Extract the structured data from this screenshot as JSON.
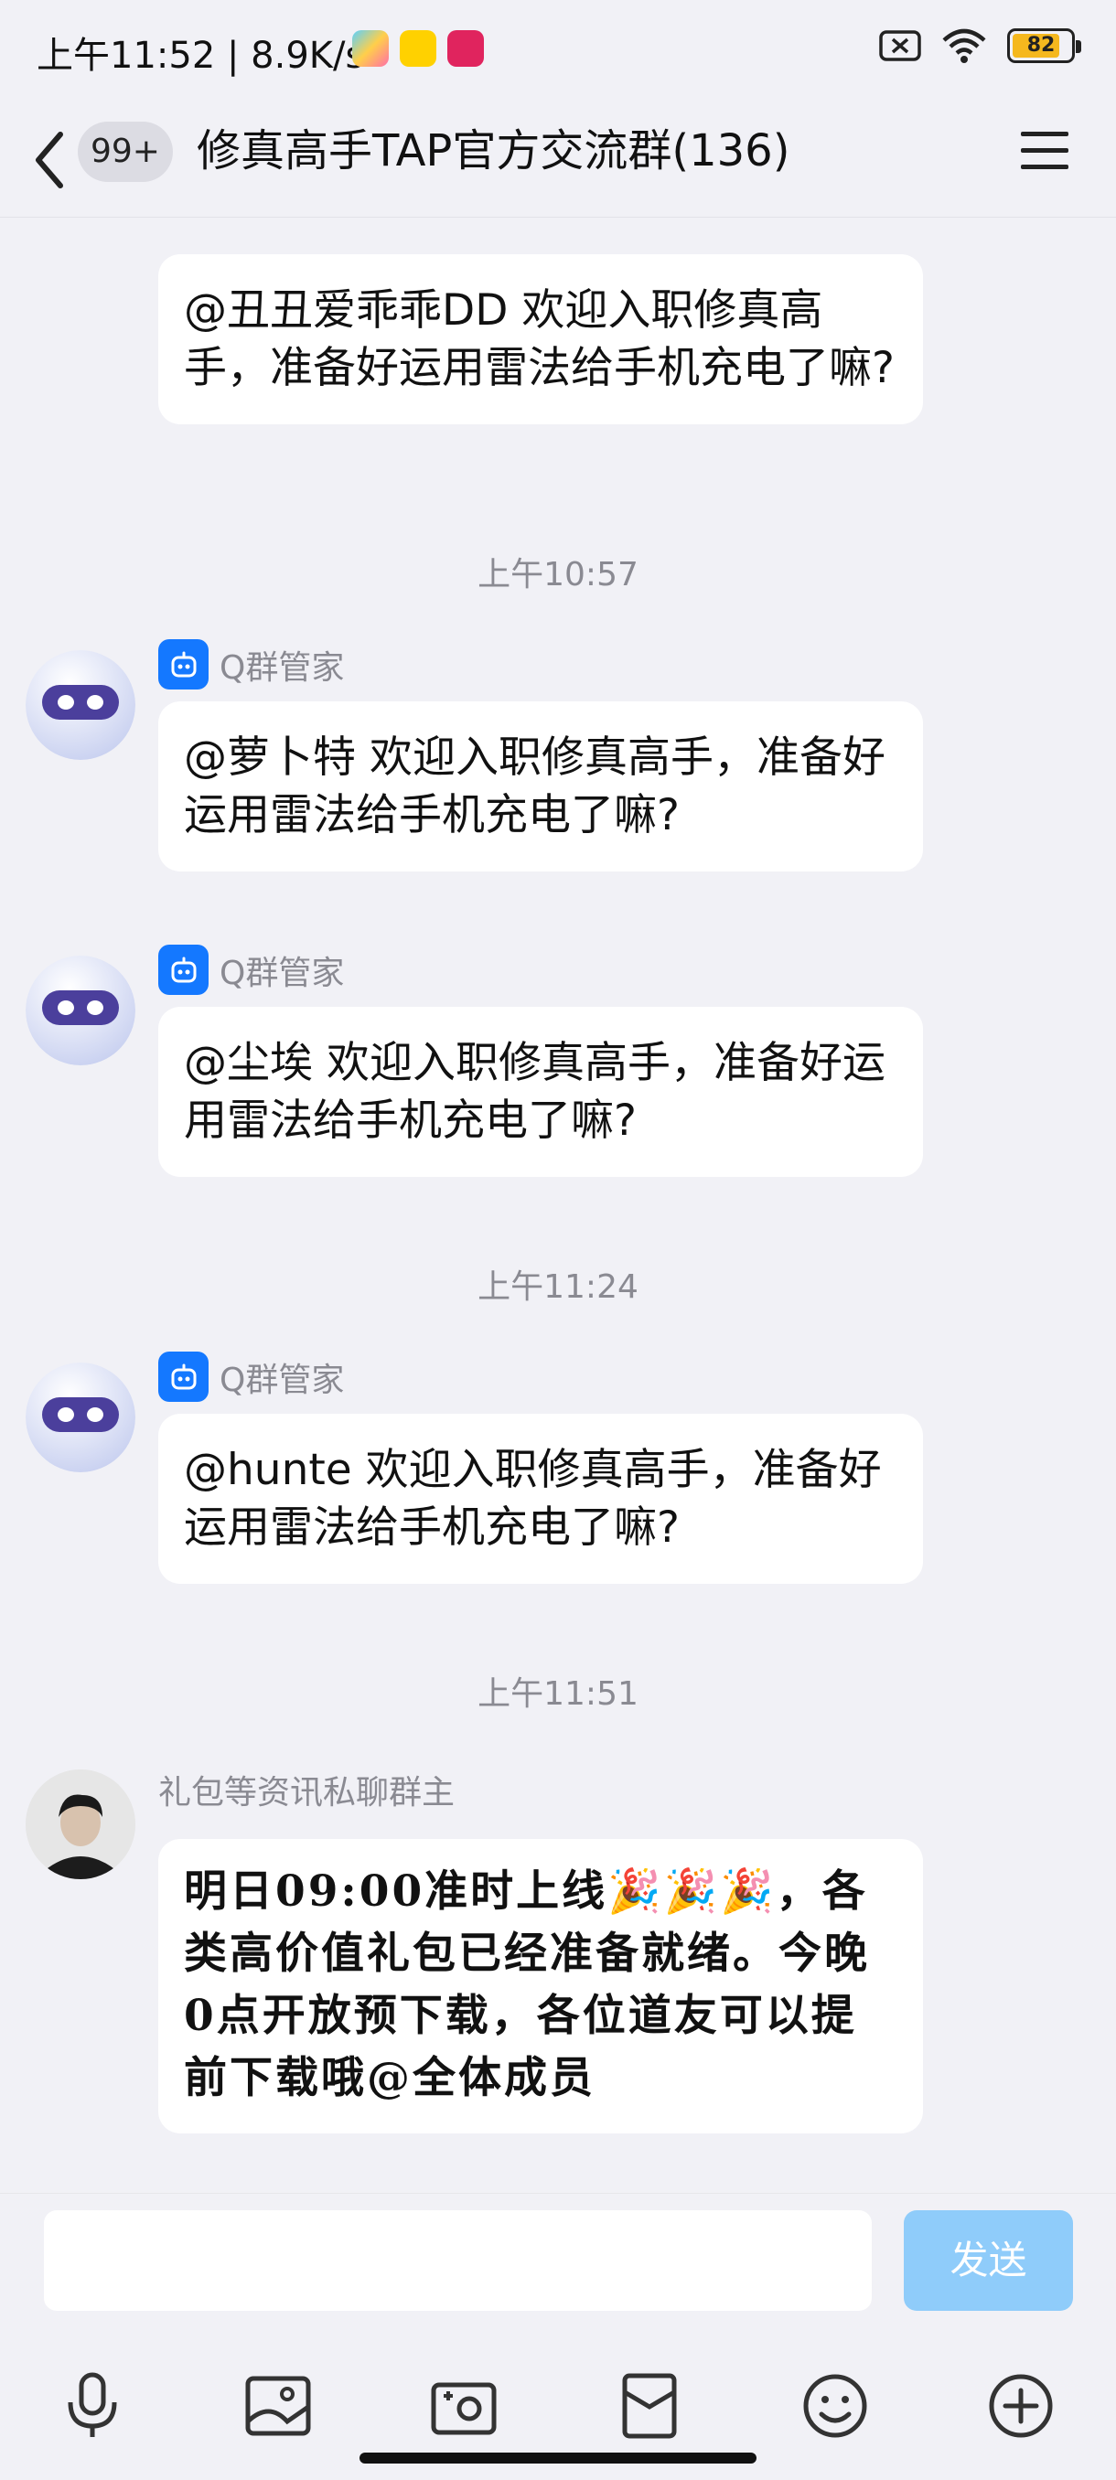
{
  "status_bar": {
    "time_info": "上午11:52 | 8.9K/s",
    "app_icons": [
      "gallery-icon",
      "meituan-icon",
      "pinduoduo-icon"
    ],
    "battery": "82"
  },
  "header": {
    "unread_badge": "99+",
    "title": "修真高手TAP官方交流群(136)"
  },
  "messages": [
    {
      "type": "bot",
      "sender": "Q群管家",
      "text": "@丑丑爱乖乖DD 欢迎入职修真高手，准备好运用雷法给手机充电了嘛?"
    },
    {
      "type": "time",
      "text": "上午10:57"
    },
    {
      "type": "bot",
      "sender": "Q群管家",
      "text": "@萝卜特 欢迎入职修真高手，准备好运用雷法给手机充电了嘛?"
    },
    {
      "type": "bot",
      "sender": "Q群管家",
      "text": "@尘埃 欢迎入职修真高手，准备好运用雷法给手机充电了嘛?"
    },
    {
      "type": "time",
      "text": "上午11:24"
    },
    {
      "type": "bot",
      "sender": "Q群管家",
      "text": "@hunte 欢迎入职修真高手，准备好运用雷法给手机充电了嘛?"
    },
    {
      "type": "time",
      "text": "上午11:51"
    },
    {
      "type": "user",
      "sender": "礼包等资讯私聊群主",
      "text_before": "明日09:00准时上线",
      "emoji": "🎉🎉🎉",
      "text_after": "，各类高价值礼包已经准备就绪。今晚0点开放预下载，各位道友可以提前下载哦@全体成员"
    }
  ],
  "input": {
    "placeholder": "",
    "send_label": "发送"
  },
  "toolbar": [
    "microphone-icon",
    "image-icon",
    "camera-icon",
    "red-packet-icon",
    "emoji-icon",
    "plus-icon"
  ],
  "colors": {
    "background": "#f1f1f6",
    "bubble": "#ffffff",
    "bot_badge": "#1478ff",
    "send_button": "#8fccfa",
    "timestamp_text": "#8a8a92"
  }
}
